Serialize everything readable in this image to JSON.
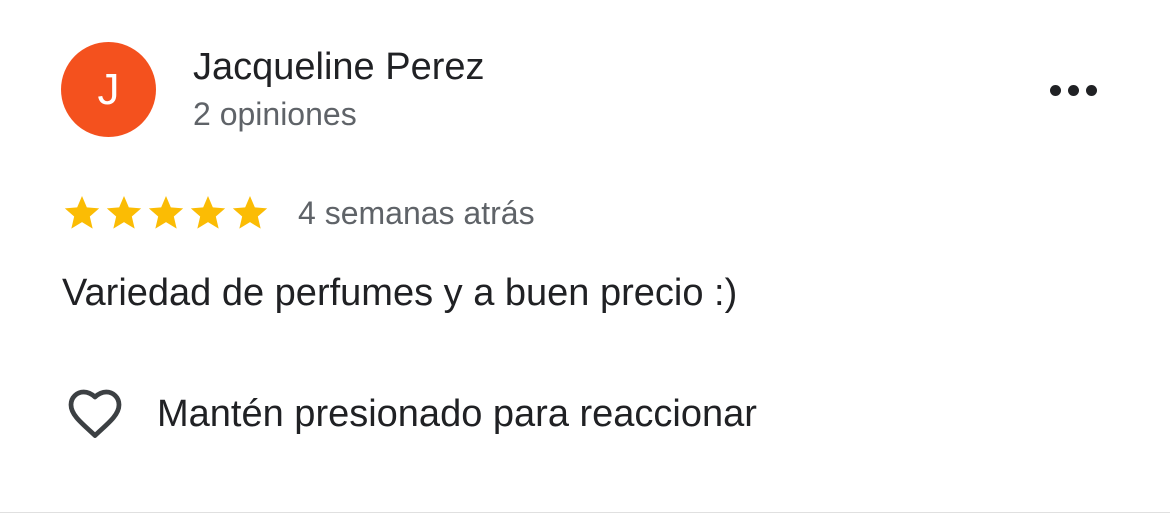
{
  "review": {
    "reviewer": {
      "avatar_initial": "J",
      "avatar_color": "#f4511e",
      "name": "Jacqueline Perez",
      "review_count": "2 opiniones"
    },
    "more_options_icon": "more-horizontal-icon",
    "rating": {
      "value": 5,
      "max": 5,
      "star_color": "#fbbc04"
    },
    "timestamp": "4 semanas atrás",
    "text": "Variedad de perfumes y a buen precio :)",
    "reaction": {
      "icon": "heart-outline-icon",
      "label": "Mantén presionado para reaccionar"
    }
  }
}
